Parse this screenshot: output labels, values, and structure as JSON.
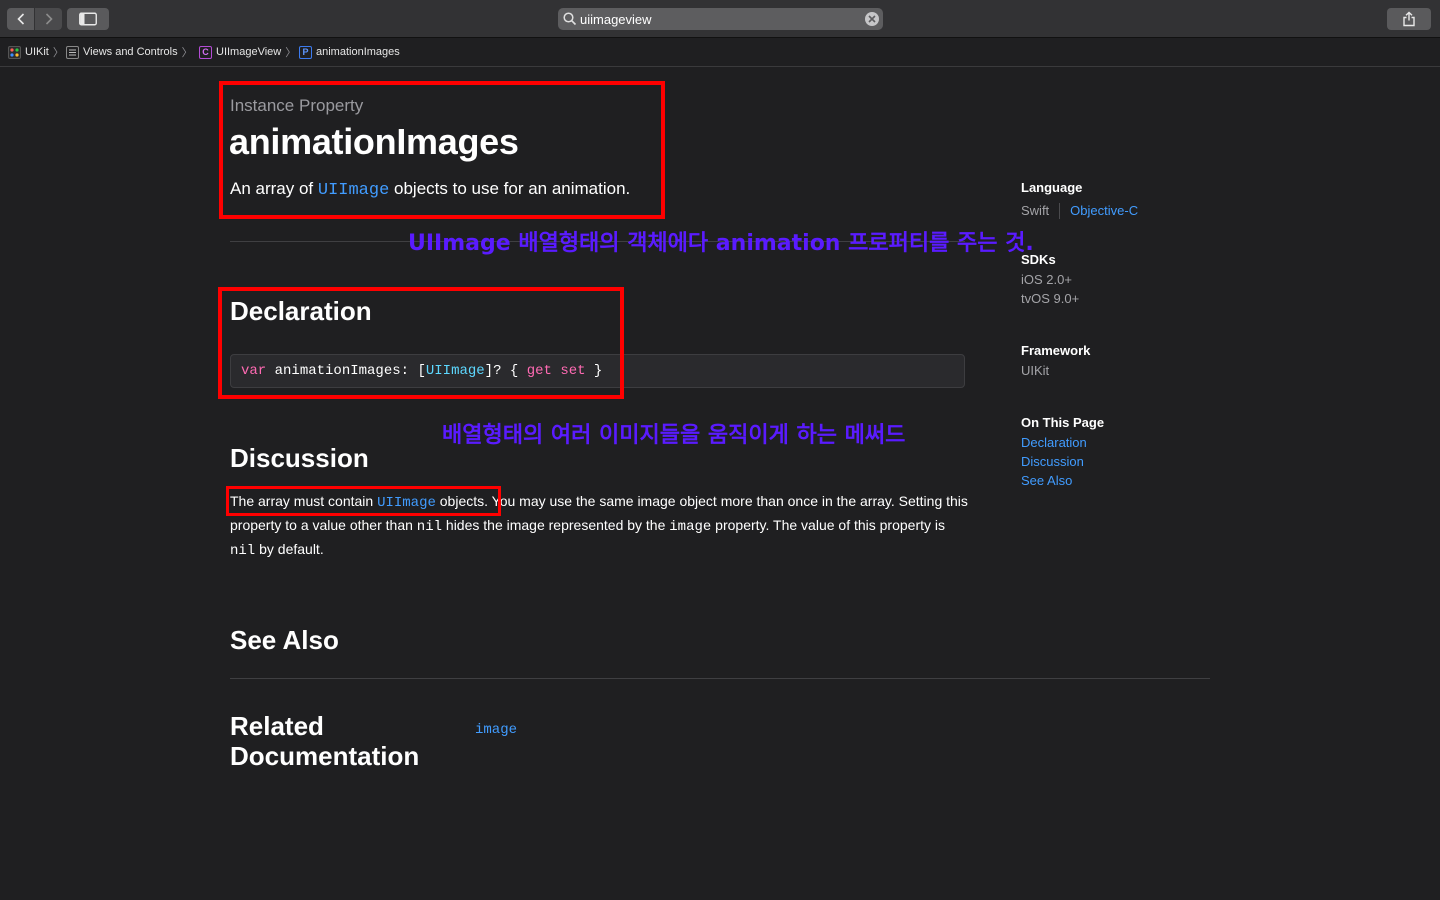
{
  "search": {
    "value": "uiimageview"
  },
  "breadcrumb": [
    {
      "label": "UIKit",
      "icon": "framework-icon"
    },
    {
      "label": "Views and Controls",
      "icon": "list-icon"
    },
    {
      "label": "UIImageView",
      "icon": "class-icon",
      "glyph": "C"
    },
    {
      "label": "animationImages",
      "icon": "property-icon",
      "glyph": "P"
    }
  ],
  "main": {
    "eyebrow": "Instance Property",
    "title": "animationImages",
    "abstract": {
      "pre": "An array of ",
      "link": "UIImage",
      "post": " objects to use for an animation."
    },
    "declaration": {
      "heading": "Declaration",
      "code": {
        "kw1": "var",
        "name": " animationImages: [",
        "type": "UIImage",
        "mid": "]? { ",
        "kw2": "get",
        "kw3": "set",
        "end": " }"
      }
    },
    "discussion": {
      "heading": "Discussion",
      "p1_pre": "The array must contain ",
      "p1_link": "UIImage",
      "p1_mid": " objects. You may use the same image object more than once in the array. Setting this property to a value other than ",
      "p1_nil1": "nil",
      "p1_mid2": " hides the image represented by the ",
      "p1_image": "image",
      "p1_mid3": " property. The value of this property is ",
      "p1_nil2": "nil",
      "p1_end": " by default."
    },
    "see_also": {
      "heading": "See Also",
      "related_heading": "Related Documentation",
      "related_link": "image"
    }
  },
  "sidebar": {
    "language_label": "Language",
    "language_swift": "Swift",
    "language_objc": "Objective-C",
    "sdks_label": "SDKs",
    "sdk_ios": "iOS 2.0+",
    "sdk_tvos": "tvOS 9.0+",
    "framework_label": "Framework",
    "framework_value": "UIKit",
    "on_this_page_label": "On This Page",
    "on_this_page": [
      "Declaration",
      "Discussion",
      "See Also"
    ]
  },
  "annotations": {
    "note1": "UIImage 배열형태의 객체에다 animation 프로퍼티를 주는 것.",
    "note2": "배열형태의 여러 이미지들을 움직이게 하는 메써드"
  },
  "colors": {
    "annotation_box": "#ff0000",
    "annotation_text": "#5a1bff",
    "link": "#419cff",
    "keyword": "#ff6ab3",
    "type": "#5dd8ff"
  }
}
